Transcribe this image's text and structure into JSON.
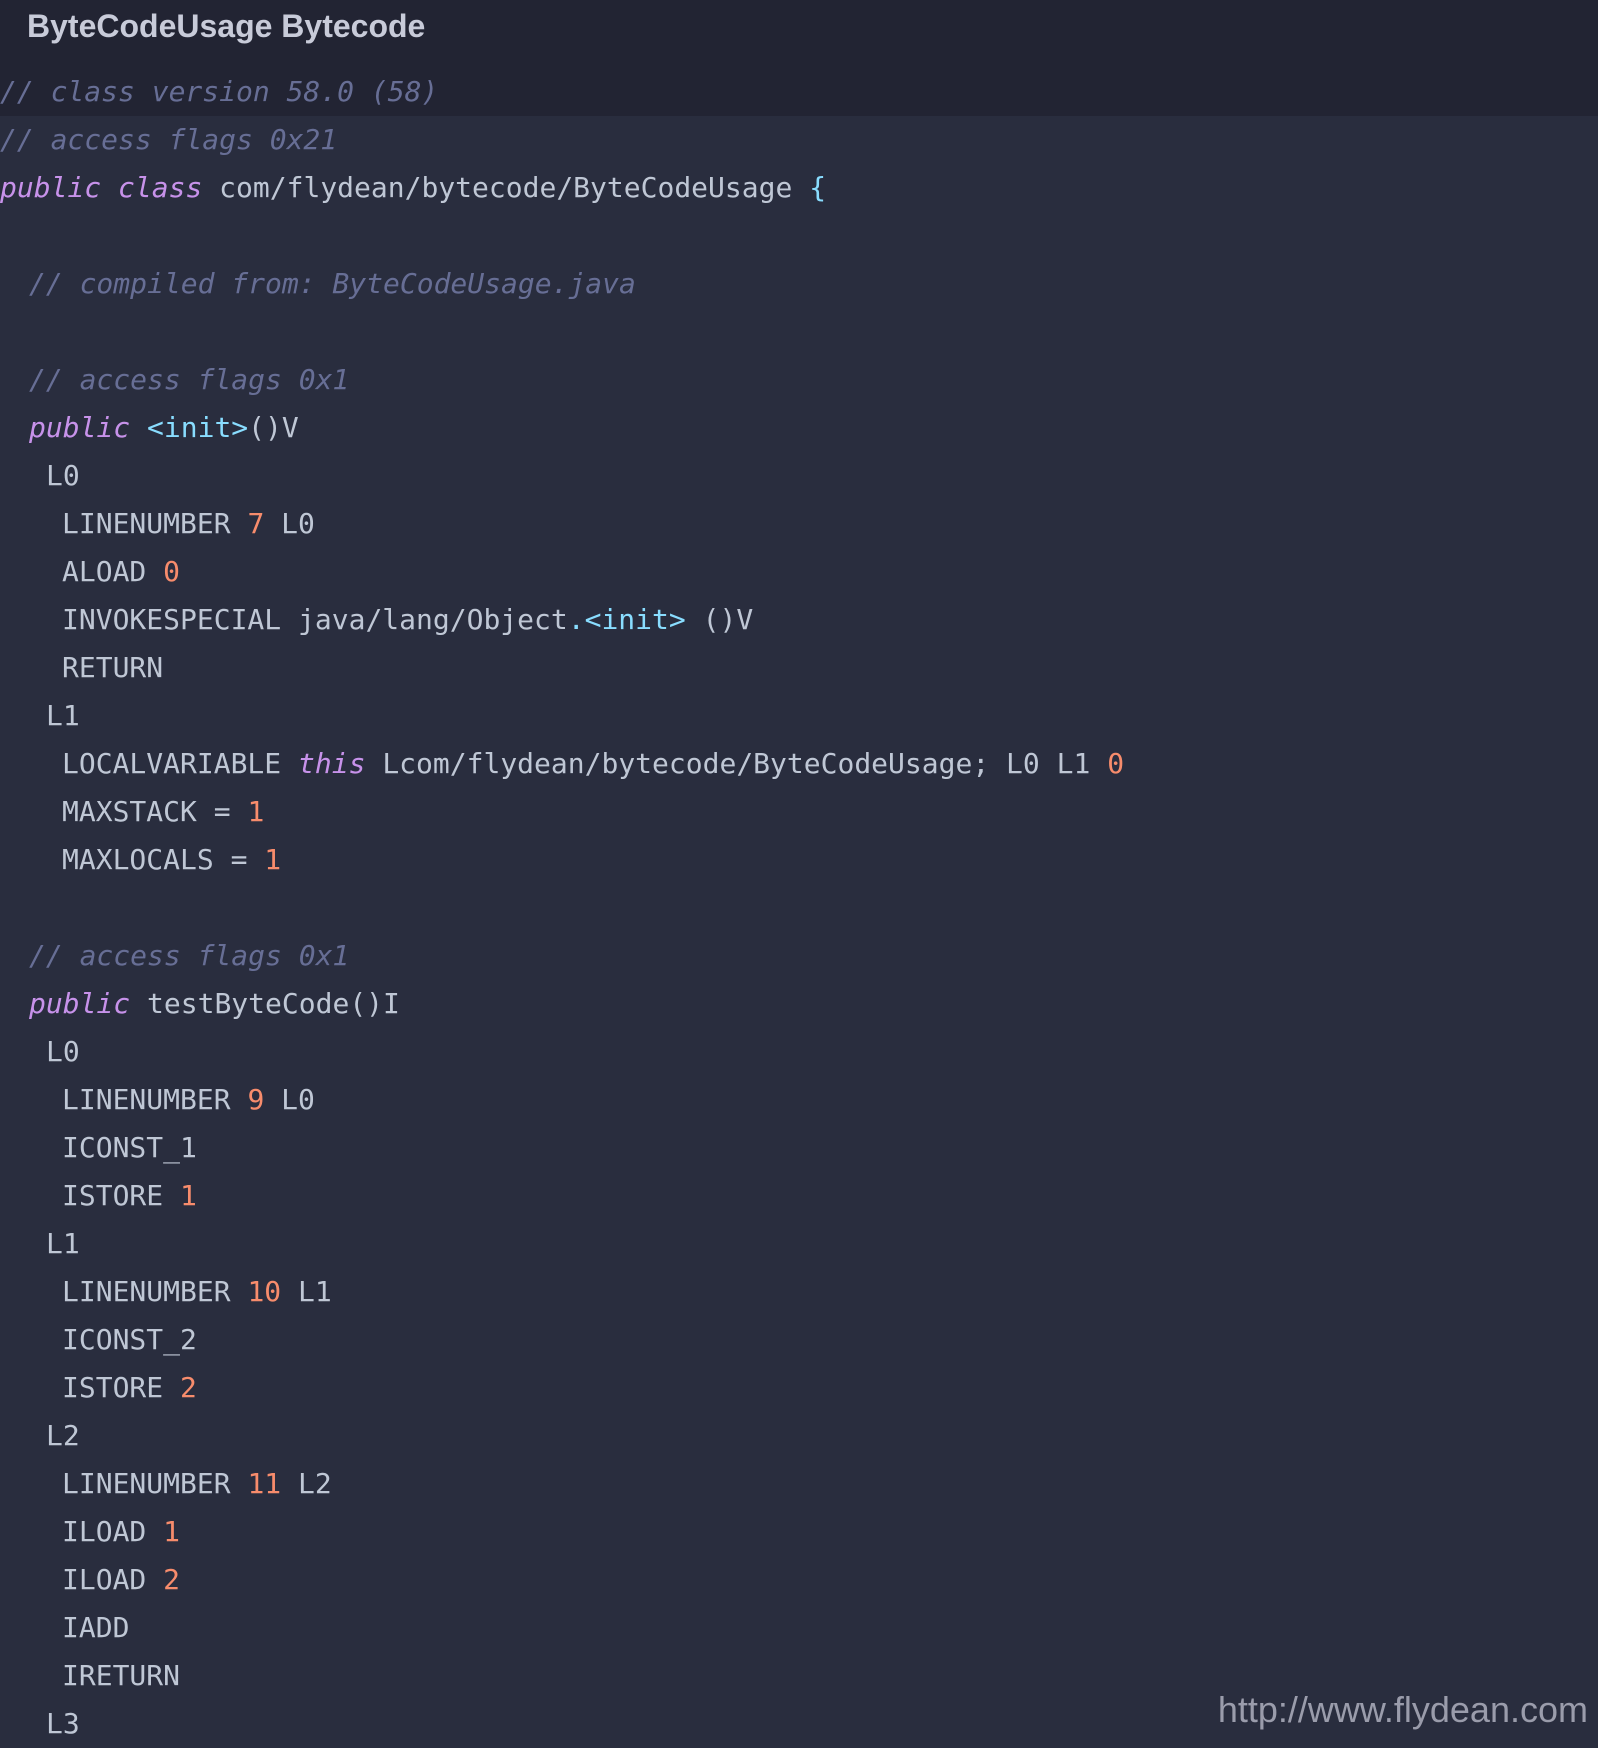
{
  "window": {
    "title": "ByteCodeUsage Bytecode"
  },
  "code": {
    "header_comment_version": "// class version 58.0 (58)",
    "class_access_comment": "// access flags 0x21",
    "class_decl": {
      "kw_public": "public",
      "kw_class": "class",
      "class_name": "com/flydean/bytecode/ByteCodeUsage",
      "brace": "{"
    },
    "compiled_from": "// compiled from: ByteCodeUsage.java",
    "method1": {
      "access_comment": "// access flags 0x1",
      "kw_public": "public",
      "name": "<init>",
      "desc": "()V",
      "label_L0": "L0",
      "linenumber": {
        "op": "LINENUMBER",
        "num": "7",
        "label": "L0"
      },
      "aload": {
        "op": "ALOAD",
        "num": "0"
      },
      "invoke": {
        "op": "INVOKESPECIAL",
        "owner": "java/lang/Object",
        "dot": ".",
        "name": "<init>",
        "desc": "()V"
      },
      "ret": "RETURN",
      "label_L1": "L1",
      "localvar": {
        "op": "LOCALVARIABLE",
        "kw_this": "this",
        "type": "Lcom/flydean/bytecode/ByteCodeUsage;",
        "labels": "L0 L1",
        "index": "0"
      },
      "maxstack": {
        "op": "MAXSTACK",
        "eq": "=",
        "num": "1"
      },
      "maxlocals": {
        "op": "MAXLOCALS",
        "eq": "=",
        "num": "1"
      }
    },
    "method2": {
      "access_comment": "// access flags 0x1",
      "kw_public": "public",
      "name": "testByteCode",
      "desc": "()I",
      "label_L0": "L0",
      "ln0": {
        "op": "LINENUMBER",
        "num": "9",
        "label": "L0"
      },
      "iconst1": "ICONST_1",
      "istore1": {
        "op": "ISTORE",
        "num": "1"
      },
      "label_L1": "L1",
      "ln1": {
        "op": "LINENUMBER",
        "num": "10",
        "label": "L1"
      },
      "iconst2": "ICONST_2",
      "istore2": {
        "op": "ISTORE",
        "num": "2"
      },
      "label_L2": "L2",
      "ln2": {
        "op": "LINENUMBER",
        "num": "11",
        "label": "L2"
      },
      "iload1": {
        "op": "ILOAD",
        "num": "1"
      },
      "iload2": {
        "op": "ILOAD",
        "num": "2"
      },
      "iadd": "IADD",
      "ireturn": "IRETURN",
      "label_L3": "L3"
    }
  },
  "watermark": "http://www.flydean.com",
  "colors": {
    "background": "#292d3e",
    "top_bar": "#222433",
    "comment": "#676e95",
    "keyword": "#c792ea",
    "number": "#f78c6c",
    "punctuation": "#89ddff",
    "text": "#bfc7d5"
  }
}
